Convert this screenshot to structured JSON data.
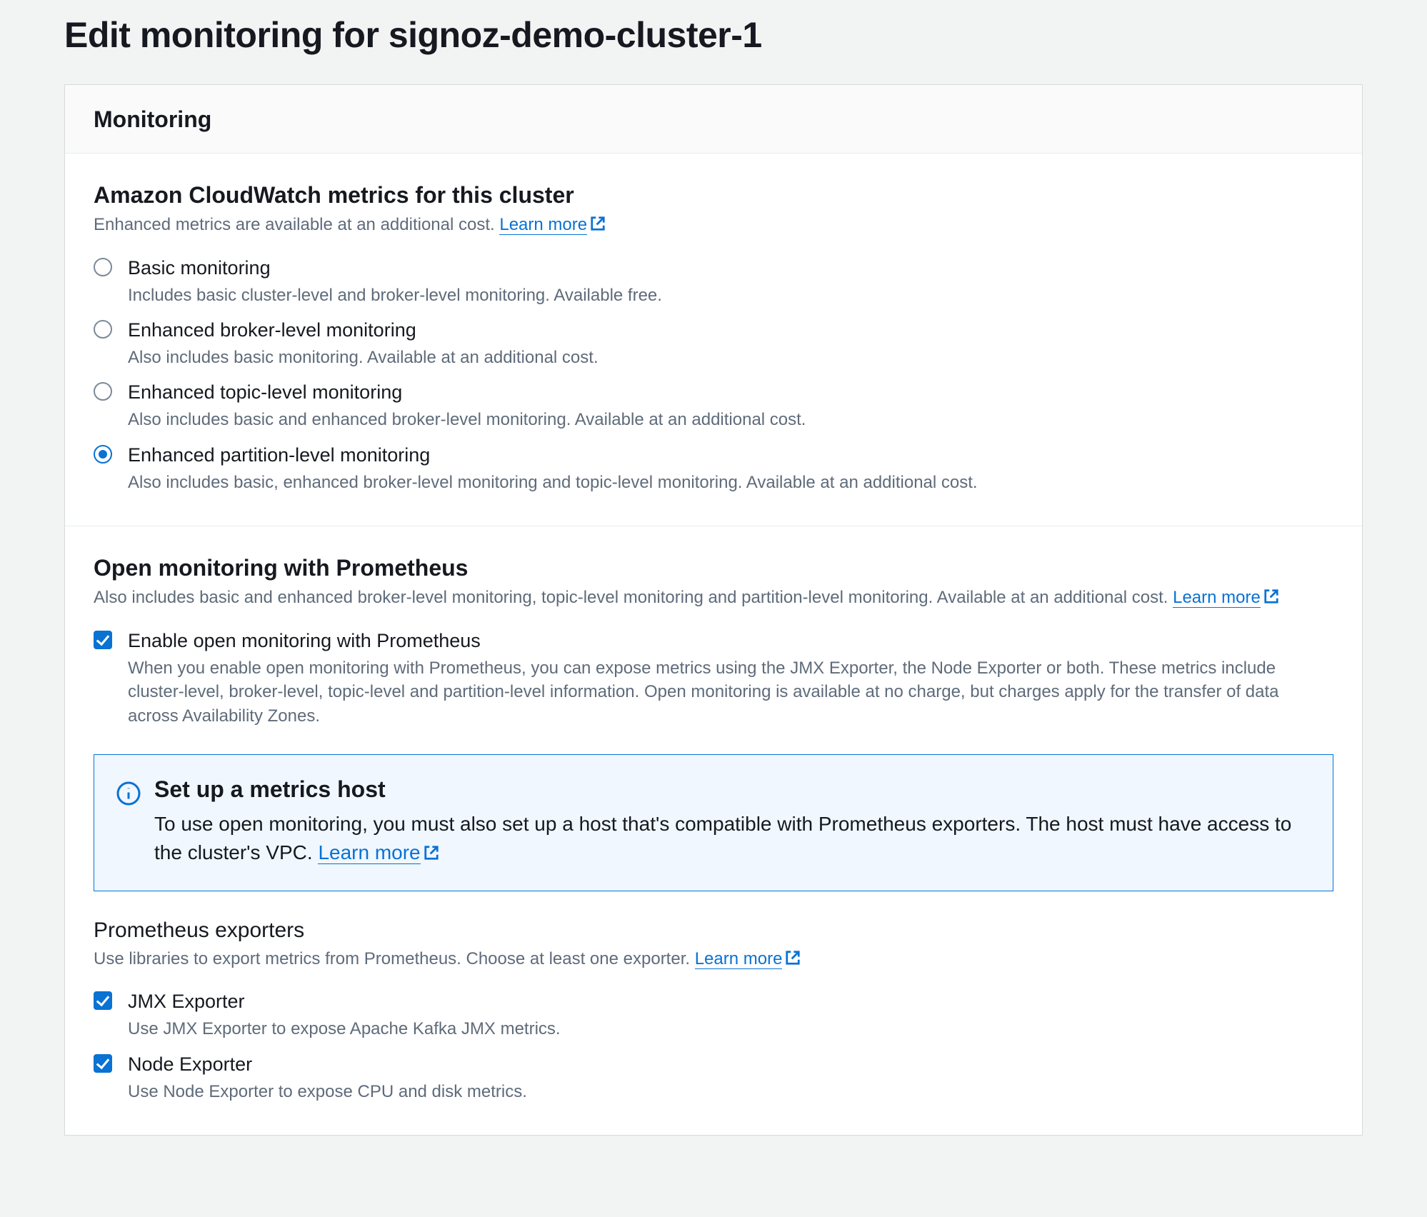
{
  "page": {
    "title": "Edit monitoring for signoz-demo-cluster-1"
  },
  "card": {
    "header_title": "Monitoring"
  },
  "cloudwatch": {
    "heading": "Amazon CloudWatch metrics for this cluster",
    "subtext": "Enhanced metrics are available at an additional cost. ",
    "learn_more": "Learn more",
    "options": [
      {
        "label": "Basic monitoring",
        "desc": "Includes basic cluster-level and broker-level monitoring. Available free.",
        "selected": false
      },
      {
        "label": "Enhanced broker-level monitoring",
        "desc": "Also includes basic monitoring. Available at an additional cost.",
        "selected": false
      },
      {
        "label": "Enhanced topic-level monitoring",
        "desc": "Also includes basic and enhanced broker-level monitoring. Available at an additional cost.",
        "selected": false
      },
      {
        "label": "Enhanced partition-level monitoring",
        "desc": "Also includes basic, enhanced broker-level monitoring and topic-level monitoring. Available at an additional cost.",
        "selected": true
      }
    ]
  },
  "prometheus": {
    "heading": "Open monitoring with Prometheus",
    "subtext": "Also includes basic and enhanced broker-level monitoring, topic-level monitoring and partition-level monitoring. Available at an additional cost. ",
    "learn_more": "Learn more",
    "enable": {
      "label": "Enable open monitoring with Prometheus",
      "desc": "When you enable open monitoring with Prometheus, you can expose metrics using the JMX Exporter, the Node Exporter or both. These metrics include cluster-level, broker-level, topic-level and partition-level information. Open monitoring is available at no charge, but charges apply for the transfer of data across Availability Zones.",
      "checked": true
    },
    "info": {
      "title": "Set up a metrics host",
      "body": "To use open monitoring, you must also set up a host that's compatible with Prometheus exporters. The host must have access to the cluster's VPC. ",
      "learn_more": "Learn more"
    }
  },
  "exporters": {
    "heading": "Prometheus exporters",
    "subtext": "Use libraries to export metrics from Prometheus. Choose at least one exporter. ",
    "learn_more": "Learn more",
    "items": [
      {
        "label": "JMX Exporter",
        "desc": "Use JMX Exporter to expose Apache Kafka JMX metrics.",
        "checked": true
      },
      {
        "label": "Node Exporter",
        "desc": "Use Node Exporter to expose CPU and disk metrics.",
        "checked": true
      }
    ]
  }
}
